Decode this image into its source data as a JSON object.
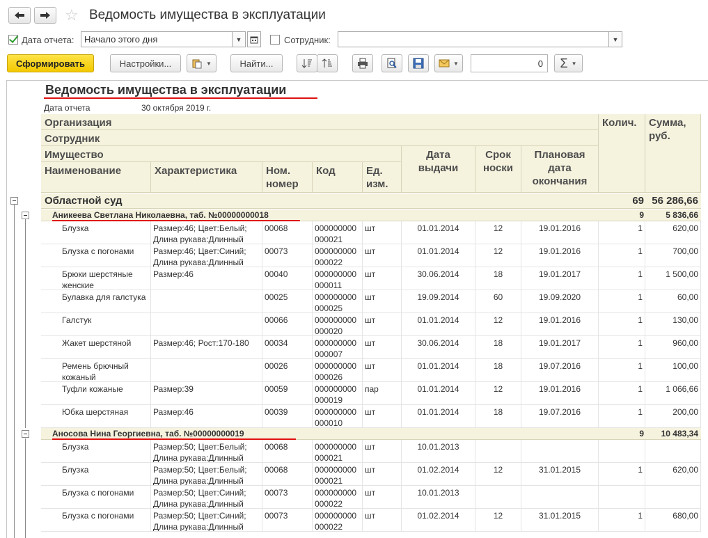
{
  "window": {
    "title": "Ведомость имущества в эксплуатации"
  },
  "filters": {
    "report_date_label": "Дата отчета:",
    "report_date_value": "Начало этого дня",
    "report_date_checked": true,
    "employee_label": "Сотрудник:",
    "employee_value": "",
    "employee_checked": false
  },
  "toolbar": {
    "generate_label": "Сформировать",
    "settings_label": "Настройки...",
    "find_label": "Найти...",
    "sum_value": "0",
    "sigma_label": "Σ"
  },
  "report": {
    "title": "Ведомость имущества в эксплуатации",
    "date_label": "Дата отчета",
    "date_value": "30 октября 2019 г.",
    "headers": {
      "org": "Организация",
      "employee": "Сотрудник",
      "property": "Имущество",
      "name": "Наименование",
      "characteristic": "Характеристика",
      "nom_number": "Ном. номер",
      "code": "Код",
      "unit": "Ед. изм.",
      "issue_date": "Дата выдачи",
      "wear_term": "Срок носки",
      "planned_end": "Плановая дата окончания",
      "qty": "Колич.",
      "sum": "Сумма, руб."
    },
    "org": {
      "name": "Областной суд",
      "qty": "69",
      "sum": "56 286,66"
    },
    "groups": [
      {
        "name": "Аникеева Светлана Николаевна, таб. №00000000018",
        "qty": "9",
        "sum": "5 836,66",
        "rows": [
          {
            "name": "Блузка",
            "char": "Размер:46; Цвет:Белый; Длина рукава:Длинный",
            "nom": "00068",
            "code": "000000000 000021",
            "unit": "шт",
            "date": "01.01.2014",
            "term": "12",
            "end": "19.01.2016",
            "qty": "1",
            "sum": "620,00"
          },
          {
            "name": "Блузка с погонами",
            "char": "Размер:46; Цвет:Синий; Длина рукава:Длинный",
            "nom": "00073",
            "code": "000000000 000022",
            "unit": "шт",
            "date": "01.01.2014",
            "term": "12",
            "end": "19.01.2016",
            "qty": "1",
            "sum": "700,00"
          },
          {
            "name": "Брюки шерстяные женские",
            "char": "Размер:46",
            "nom": "00040",
            "code": "000000000 000011",
            "unit": "шт",
            "date": "30.06.2014",
            "term": "18",
            "end": "19.01.2017",
            "qty": "1",
            "sum": "1 500,00"
          },
          {
            "name": "Булавка для галстука",
            "char": "",
            "nom": "00025",
            "code": "000000000 000025",
            "unit": "шт",
            "date": "19.09.2014",
            "term": "60",
            "end": "19.09.2020",
            "qty": "1",
            "sum": "60,00"
          },
          {
            "name": "Галстук",
            "char": "",
            "nom": "00066",
            "code": "000000000 000020",
            "unit": "шт",
            "date": "01.01.2014",
            "term": "12",
            "end": "19.01.2016",
            "qty": "1",
            "sum": "130,00"
          },
          {
            "name": "Жакет шерстяной",
            "char": "Размер:46; Рост:170-180",
            "nom": "00034",
            "code": "000000000 000007",
            "unit": "шт",
            "date": "30.06.2014",
            "term": "18",
            "end": "19.01.2017",
            "qty": "1",
            "sum": "960,00"
          },
          {
            "name": "Ремень брючный кожаный",
            "char": "",
            "nom": "00026",
            "code": "000000000 000026",
            "unit": "шт",
            "date": "01.01.2014",
            "term": "18",
            "end": "19.07.2016",
            "qty": "1",
            "sum": "100,00"
          },
          {
            "name": "Туфли кожаные",
            "char": "Размер:39",
            "nom": "00059",
            "code": "000000000 000019",
            "unit": "пар",
            "date": "01.01.2014",
            "term": "12",
            "end": "19.01.2016",
            "qty": "1",
            "sum": "1 066,66"
          },
          {
            "name": "Юбка шерстяная",
            "char": "Размер:46",
            "nom": "00039",
            "code": "000000000 000010",
            "unit": "шт",
            "date": "01.01.2014",
            "term": "18",
            "end": "19.07.2016",
            "qty": "1",
            "sum": "200,00"
          }
        ]
      },
      {
        "name": "Аносова Нина Георгиевна, таб. №00000000019",
        "qty": "9",
        "sum": "10 483,34",
        "rows": [
          {
            "name": "Блузка",
            "char": "Размер:50; Цвет:Белый; Длина рукава:Длинный",
            "nom": "00068",
            "code": "000000000 000021",
            "unit": "шт",
            "date": "10.01.2013",
            "term": "",
            "end": "",
            "qty": "",
            "sum": ""
          },
          {
            "name": "Блузка",
            "char": "Размер:50; Цвет:Белый; Длина рукава:Длинный",
            "nom": "00068",
            "code": "000000000 000021",
            "unit": "шт",
            "date": "01.02.2014",
            "term": "12",
            "end": "31.01.2015",
            "qty": "1",
            "sum": "620,00"
          },
          {
            "name": "Блузка с погонами",
            "char": "Размер:50; Цвет:Синий; Длина рукава:Длинный",
            "nom": "00073",
            "code": "000000000 000022",
            "unit": "шт",
            "date": "10.01.2013",
            "term": "",
            "end": "",
            "qty": "",
            "sum": ""
          },
          {
            "name": "Блузка с погонами",
            "char": "Размер:50; Цвет:Синий; Длина рукава:Длинный",
            "nom": "00073",
            "code": "000000000 000022",
            "unit": "шт",
            "date": "01.02.2014",
            "term": "12",
            "end": "31.01.2015",
            "qty": "1",
            "sum": "680,00"
          }
        ]
      }
    ]
  }
}
